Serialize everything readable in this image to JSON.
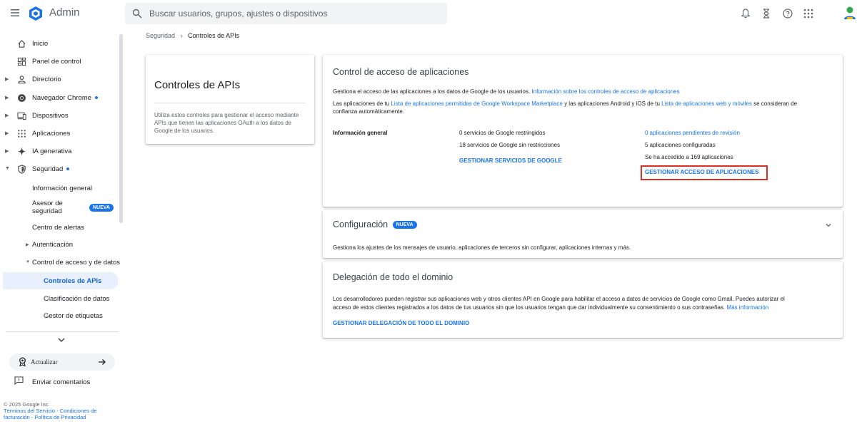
{
  "app": {
    "title": "Admin"
  },
  "search": {
    "placeholder": "Buscar usuarios, grupos, ajustes o dispositivos"
  },
  "topbar_icons": [
    "bell-icon",
    "hourglass-icon",
    "help-icon",
    "apps-grid-icon",
    "user-avatar"
  ],
  "colors": {
    "accent": "#1a73e8",
    "active_bg": "#e8f0fe",
    "highlight": "#d93025"
  },
  "sidebar": {
    "items": [
      {
        "label": "Inicio",
        "icon": "home-icon"
      },
      {
        "label": "Panel de control",
        "icon": "dashboard-icon"
      },
      {
        "label": "Directorio",
        "icon": "person-icon"
      },
      {
        "label": "Navegador Chrome",
        "icon": "chrome-icon"
      },
      {
        "label": "Dispositivos",
        "icon": "devices-icon"
      },
      {
        "label": "Aplicaciones",
        "icon": "apps-icon"
      },
      {
        "label": "IA generativa",
        "icon": "sparkle-icon"
      },
      {
        "label": "Seguridad",
        "icon": "shield-icon"
      }
    ],
    "security_sub": {
      "info": "Información general",
      "advisor_line1": "Asesor de",
      "advisor_line2": "seguridad",
      "advisor_badge": "NUEVA",
      "alerts": "Centro de alertas",
      "auth": "Autenticación",
      "access": "Control de acceso y de datos",
      "api": "Controles de APIs",
      "classification": "Clasificación de datos",
      "labels": "Gestor de etiquetas"
    },
    "upgrade": "Actualizar",
    "feedback": "Enviar comentarios",
    "footer": {
      "copyright": "© 2025 Google Inc.",
      "terms": "Términos del Servicio",
      "billing_line1": "Condiciones de",
      "billing_line2": "facturación",
      "privacy": "Política de Privacidad"
    }
  },
  "breadcrumb": {
    "parent": "Seguridad",
    "current": "Controles de APIs"
  },
  "left_card": {
    "title": "Controles de APIs",
    "description": "Utiliza estos controles para gestionar el acceso mediante APIs que tienen las aplicaciones OAuth a los datos de Google de los usuarios."
  },
  "app_access": {
    "title": "Control de acceso de aplicaciones",
    "desc_prefix": "Gestiona el acceso de las aplicaciones a los datos de Google de los usuarios.",
    "desc_link": "Información sobre los controles de acceso de aplicaciones",
    "trust_prefix": "Las aplicaciones de tu",
    "trust_link1": "Lista de aplicaciones permitidas de Google Workspace Marketplace",
    "trust_mid": "y las aplicaciones Android y iOS de tu",
    "trust_link2": "Lista de aplicaciones web y móviles",
    "trust_suffix": "se consideran de",
    "trust_line2": "confianza automáticamente.",
    "overview_label": "Información general",
    "restricted": "0 servicios de Google restringidos",
    "unrestricted": "18 servicios de Google sin restricciones",
    "manage_services": "GESTIONAR SERVICIOS DE GOOGLE",
    "pending": "0 aplicaciones pendientes de revisión",
    "configured": "5 aplicaciones configuradas",
    "accessed": "Se ha accedido a 169 aplicaciones",
    "manage_apps": "GESTIONAR ACCESO DE APLICACIONES"
  },
  "config": {
    "title": "Configuración",
    "badge": "NUEVA",
    "desc": "Gestiona los ajustes de los mensajes de usuario, aplicaciones de terceros sin configurar, aplicaciones internas y más."
  },
  "delegation": {
    "title": "Delegación de todo el dominio",
    "desc_line1": "Los desarrolladores pueden registrar sus aplicaciones web y otros clientes API en Google para habilitar el acceso a datos de servicios de Google como Gmail. Puedes autorizar el",
    "desc_line2": "acceso de estos clientes registrados a los datos de tus usuarios sin que los usuarios tengan que dar individualmente su consentimiento o sus contraseñas.",
    "more_link": "Más información",
    "action": "GESTIONAR DELEGACIÓN DE TODO EL DOMINIO"
  }
}
